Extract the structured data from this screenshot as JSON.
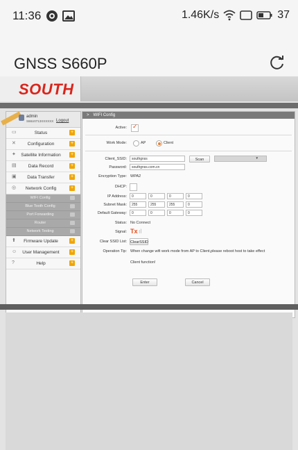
{
  "statusbar": {
    "time": "11:36",
    "right_text": "1.46K/s",
    "battery": "37"
  },
  "app": {
    "title": "GNSS S660P"
  },
  "web": {
    "logo": "SOUTH"
  },
  "user": {
    "name": "admin",
    "serial": "S66U0713XXXXXX",
    "logout": "Logout"
  },
  "menu": {
    "items": [
      {
        "label": "Status",
        "icon": "monitor-icon",
        "glyph": "▭"
      },
      {
        "label": "Configuration",
        "icon": "tools-icon",
        "glyph": "✕"
      },
      {
        "label": "Satellite Information",
        "icon": "satellite-icon",
        "glyph": "✦"
      },
      {
        "label": "Data Record",
        "icon": "record-icon",
        "glyph": "▤"
      },
      {
        "label": "Data Transfer",
        "icon": "transfer-icon",
        "glyph": "▣"
      },
      {
        "label": "Network Config",
        "icon": "network-icon",
        "glyph": "◎"
      }
    ],
    "sub": [
      "WIFI Config",
      "Blue Tooth Config",
      "Port Forwarding",
      "Router",
      "Network Testing"
    ],
    "bottom": [
      {
        "label": "Firmware Update",
        "icon": "upload-icon",
        "glyph": "⬆"
      },
      {
        "label": "User Management",
        "icon": "users-icon",
        "glyph": "☺"
      },
      {
        "label": "Help",
        "icon": "help-icon",
        "glyph": "?"
      }
    ]
  },
  "panel": {
    "title": "WIFI Config",
    "active_label": "Active:",
    "work_mode_label": "Work Mode:",
    "ap_label": "AP",
    "client_label": "Client",
    "ssid_label": "Client_SSID:",
    "ssid_value": "southgnss",
    "scan_label": "Scan",
    "password_label": "Password:",
    "password_value": "southgnss.com.cn",
    "encryption_label": "Encryption Type:",
    "encryption_value": "WPA2",
    "dhcp_label": "DHCP:",
    "ip_label": "IP Address:",
    "ip": [
      "0",
      "0",
      "0",
      "0"
    ],
    "mask_label": "Subnet Mask:",
    "mask": [
      "255",
      "255",
      "255",
      "0"
    ],
    "gw_label": "Default Gateway:",
    "gw": [
      "0",
      "0",
      "0",
      "0"
    ],
    "status_label": "Status:",
    "status_value": "No Connect",
    "signal_label": "Signal:",
    "signal_value": "Tx",
    "clear_label": "Clear SSID List:",
    "clear_button": "ClearSSID",
    "tip_label": "Operation Tip:",
    "tip_line1": "When change wifi work mode from AP to Client,please reboot host to take effect",
    "tip_line2": "Client function!",
    "enter": "Enter",
    "cancel": "Cancel"
  },
  "colors": {
    "accent": "#f0a500",
    "logo": "#d9241b",
    "check": "#e74c1c"
  }
}
